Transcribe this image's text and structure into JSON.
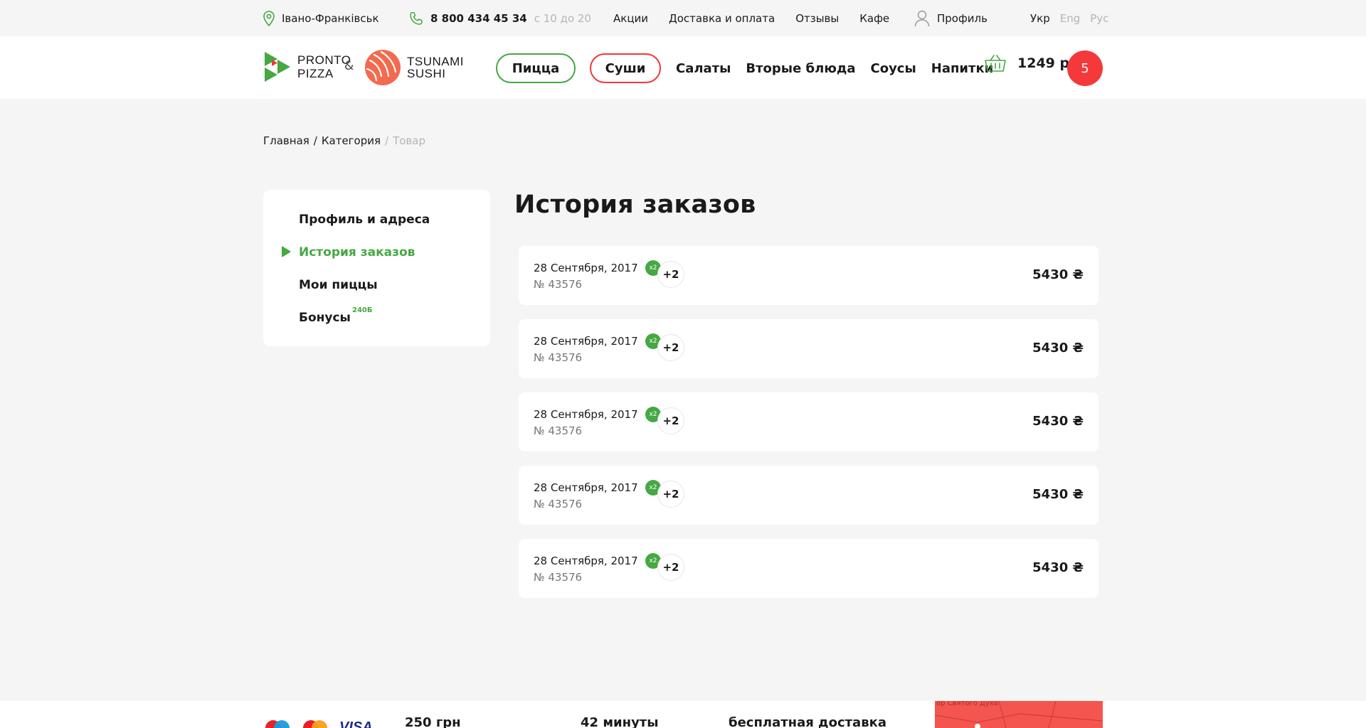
{
  "topbar": {
    "city": "Івано-Франківськ",
    "phone": "8 800 434 45 34",
    "hours": "с 10 до 20",
    "nav": [
      "Акции",
      "Доставка и оплата",
      "Отзывы",
      "Кафе"
    ],
    "profile": "Профиль",
    "languages": [
      "Укр",
      "Eng",
      "Рус"
    ],
    "active_language": "Укр"
  },
  "header": {
    "logo_pronto": [
      "PRONTO",
      "PIZZA"
    ],
    "amp": "&",
    "logo_sushi": [
      "TSUNAMI",
      "SUSHI"
    ],
    "nav": {
      "pizza": "Пицца",
      "sushi": "Суши",
      "salads": "Салаты",
      "mains": "Вторые блюда",
      "sauces": "Соусы",
      "drinks": "Напитки"
    },
    "cart_total": "1249 р",
    "cart_count": "5"
  },
  "breadcrumb": {
    "home": "Главная",
    "sep1": "/",
    "category": "Категория",
    "sep2": "/",
    "current": "Товар"
  },
  "sidebar": {
    "items": [
      "Профиль и адреса",
      "История заказов",
      "Мои пиццы",
      "Бонусы"
    ],
    "active_index": 1,
    "bonus_badge": "240Б"
  },
  "main": {
    "title": "История заказов",
    "orders": [
      {
        "date": "28 Сентября, 2017",
        "number": "№ 43576",
        "thumb": "x2",
        "more": "+2",
        "price": "5430 ₴"
      },
      {
        "date": "28 Сентября, 2017",
        "number": "№ 43576",
        "thumb": "x2",
        "more": "+2",
        "price": "5430 ₴"
      },
      {
        "date": "28 Сентября, 2017",
        "number": "№ 43576",
        "thumb": "x2",
        "more": "+2",
        "price": "5430 ₴"
      },
      {
        "date": "28 Сентября, 2017",
        "number": "№ 43576",
        "thumb": "x2",
        "more": "+2",
        "price": "5430 ₴"
      },
      {
        "date": "28 Сентября, 2017",
        "number": "№ 43576",
        "thumb": "x2",
        "more": "+2",
        "price": "5430 ₴"
      }
    ]
  },
  "footer": {
    "min_order": "250 грн",
    "delivery_time": "42 минуты",
    "free_delivery": "бесплатная доставка",
    "map_label": "ор Святого Духа"
  },
  "colors": {
    "green": "#45a842",
    "red": "#f2373b",
    "sushi_orange": "#f46a4e",
    "background": "#f5f5f5"
  },
  "icons": [
    "location-pin-icon",
    "phone-icon",
    "user-icon",
    "basket-icon",
    "play-arrow-icon",
    "mastercard-icon",
    "visa-icon",
    "maestro-icon"
  ]
}
